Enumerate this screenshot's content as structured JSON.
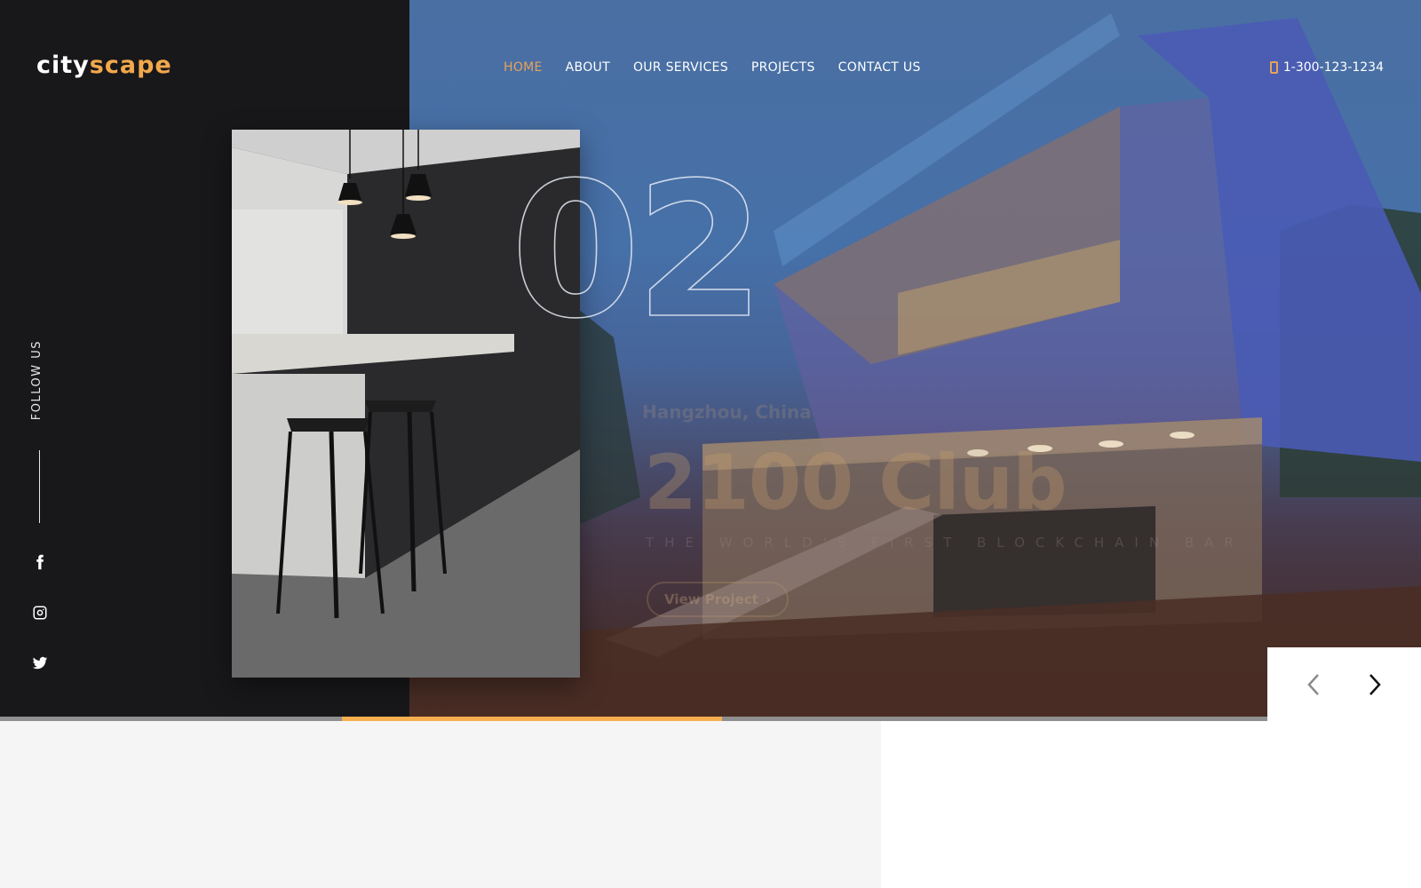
{
  "brand": {
    "logo_part_a": "city",
    "logo_part_b": "scape",
    "accent_color": "#f2a84b"
  },
  "nav": {
    "items": [
      {
        "label": "HOME",
        "active": true
      },
      {
        "label": "ABOUT",
        "active": false
      },
      {
        "label": "OUR SERVICES",
        "active": false
      },
      {
        "label": "PROJECTS",
        "active": false
      },
      {
        "label": "CONTACT US",
        "active": false
      }
    ]
  },
  "contact": {
    "phone": "1-300-123-1234",
    "icon": "mobile-phone-icon"
  },
  "social": {
    "label": "FOLLOW US",
    "items": [
      {
        "name": "facebook",
        "icon": "facebook-icon"
      },
      {
        "name": "instagram",
        "icon": "instagram-icon"
      },
      {
        "name": "twitter",
        "icon": "twitter-icon"
      }
    ]
  },
  "slide": {
    "number": "02",
    "location": "Hangzhou, China",
    "title": "2100 Club",
    "subtitle": "THE WORLD'S FIRST BLOCKCHAIN BAR",
    "cta_label": "View Project",
    "cta_icon": "chevron-right-icon"
  },
  "slider": {
    "progress_start_fraction": 0.27,
    "progress_end_fraction": 0.57,
    "prev_icon": "chevron-left-icon",
    "next_icon": "chevron-right-icon"
  }
}
